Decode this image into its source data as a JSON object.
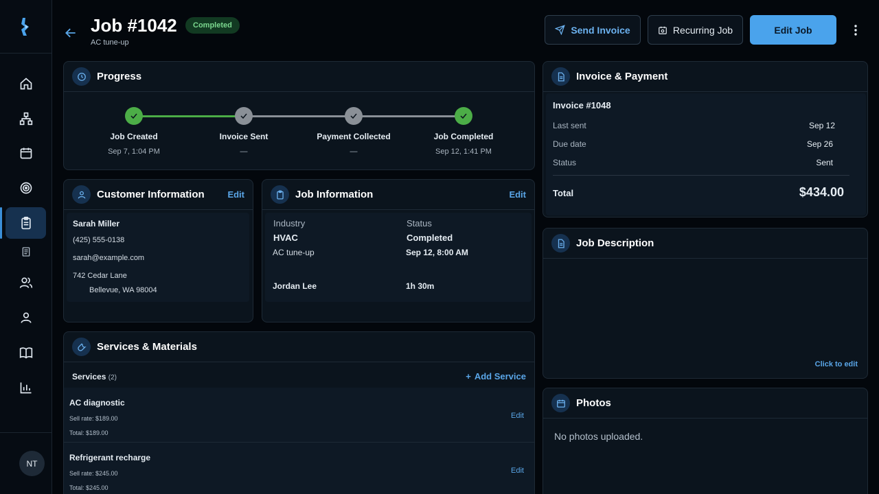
{
  "sidebar": {
    "items": [
      {
        "icon": "home-icon"
      },
      {
        "icon": "org-chart-icon"
      },
      {
        "icon": "calendar-icon"
      },
      {
        "icon": "target-icon"
      },
      {
        "icon": "clipboard-icon"
      },
      {
        "icon": "document-icon"
      },
      {
        "icon": "users-icon"
      },
      {
        "icon": "user-icon"
      },
      {
        "icon": "book-icon"
      },
      {
        "icon": "bar-chart-icon"
      }
    ],
    "avatar_initials": "NT"
  },
  "header": {
    "title": "Job #1042",
    "subtitle": "AC tune-up",
    "status_badge": "Completed",
    "send_invoice_label": "Send Invoice",
    "recurring_job_label": "Recurring Job",
    "edit_job_label": "Edit Job"
  },
  "progress": {
    "title": "Progress",
    "steps": [
      {
        "label": "Job Created",
        "date": "Sep 7, 1:04 PM",
        "state": "done"
      },
      {
        "label": "Invoice Sent",
        "date": "—",
        "state": "todo"
      },
      {
        "label": "Payment Collected",
        "date": "—",
        "state": "todo"
      },
      {
        "label": "Job Completed",
        "date": "Sep 12, 1:41 PM",
        "state": "done"
      }
    ]
  },
  "customer": {
    "title": "Customer Information",
    "edit_label": "Edit",
    "name": "Sarah Miller",
    "phone": "(425) 555-0138",
    "email": "sarah@example.com",
    "address_line1": "742 Cedar Lane",
    "address_line2": "Bellevue, WA 98004"
  },
  "job_info": {
    "title": "Job Information",
    "edit_label": "Edit",
    "industry_label": "Industry",
    "industry_value": "HVAC",
    "status_label": "Status",
    "status_value": "Completed",
    "service": "AC tune-up",
    "scheduled": "Sep 12, 8:00 AM",
    "technician": "Jordan Lee",
    "duration": "1h 30m"
  },
  "services": {
    "title": "Services & Materials",
    "section_label": "Services",
    "count": "(2)",
    "add_label": "Add Service",
    "items": [
      {
        "name": "AC diagnostic",
        "sell_rate": "Sell rate: $189.00",
        "total": "Total: $189.00",
        "edit_label": "Edit"
      },
      {
        "name": "Refrigerant recharge",
        "sell_rate": "Sell rate: $245.00",
        "total": "Total: $245.00",
        "edit_label": "Edit"
      }
    ]
  },
  "invoice": {
    "title": "Invoice & Payment",
    "number": "Invoice #1048",
    "last_sent_label": "Last sent",
    "last_sent_value": "Sep 12",
    "due_date_label": "Due date",
    "due_date_value": "Sep 26",
    "status_label": "Status",
    "status_value": "Sent",
    "total_label": "Total",
    "total_value": "$434.00"
  },
  "description": {
    "title": "Job Description",
    "click_to_edit": "Click to edit"
  },
  "photos": {
    "title": "Photos",
    "empty_text": "No photos uploaded."
  },
  "colors": {
    "accent": "#4aa3ec",
    "success": "#4cad47",
    "badge_bg": "#123a22",
    "badge_text": "#7bd88f",
    "background": "#03070c",
    "card": "#0b141d"
  }
}
